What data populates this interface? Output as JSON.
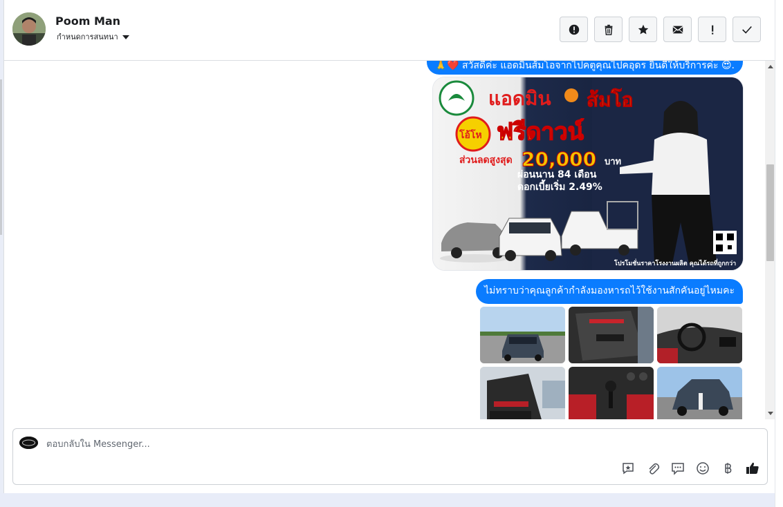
{
  "header": {
    "contact_name": "Poom Man",
    "assign_label": "กำหนดการสนทนา",
    "actions": [
      {
        "name": "report-spam-button",
        "icon": "alert-circle-icon"
      },
      {
        "name": "delete-button",
        "icon": "trash-icon"
      },
      {
        "name": "star-button",
        "icon": "star-icon"
      },
      {
        "name": "mark-unread-button",
        "icon": "envelope-icon"
      },
      {
        "name": "follow-up-button",
        "icon": "exclamation-icon"
      },
      {
        "name": "mark-done-button",
        "icon": "check-icon"
      }
    ]
  },
  "thread": {
    "greeting_text": "🙏❤️ สวัสดีค่ะ แอดมินส้มโอจากไปคตูคุณไปคอุดร ยินดีให้บริการค่ะ 😍.",
    "promo": {
      "title_left": "แอดมิน",
      "title_right": "ส้มโอ",
      "badge": "โอ้โห",
      "headline": "ฟรีดาวน์",
      "discount_label": "ส่วนลดสูงสุด",
      "discount_value": "20,000",
      "currency": "บาท",
      "installment": "ผ่อนนาน 84 เดือน",
      "interest": "ดอกเบี้ยเริ่ม 2.49%",
      "footer": "โปรโมชั่นราคาโรงงานผลิต คุณได้รถที่ถูกกว่า"
    },
    "question_text": "ไม่ทราบว่าคุณลูกค้ากำลังมองหารถไว้ใช้งานสักคันอยู่ไหมคะ"
  },
  "composer": {
    "placeholder": "ตอบกลับใน Messenger...",
    "tools": [
      "saved-reply-icon",
      "attachment-icon",
      "chat-bubble-icon",
      "emoji-icon",
      "baht-icon",
      "thumbs-up-icon"
    ]
  },
  "colors": {
    "bubble": "#0a7cff",
    "border": "#ccd0d5"
  }
}
